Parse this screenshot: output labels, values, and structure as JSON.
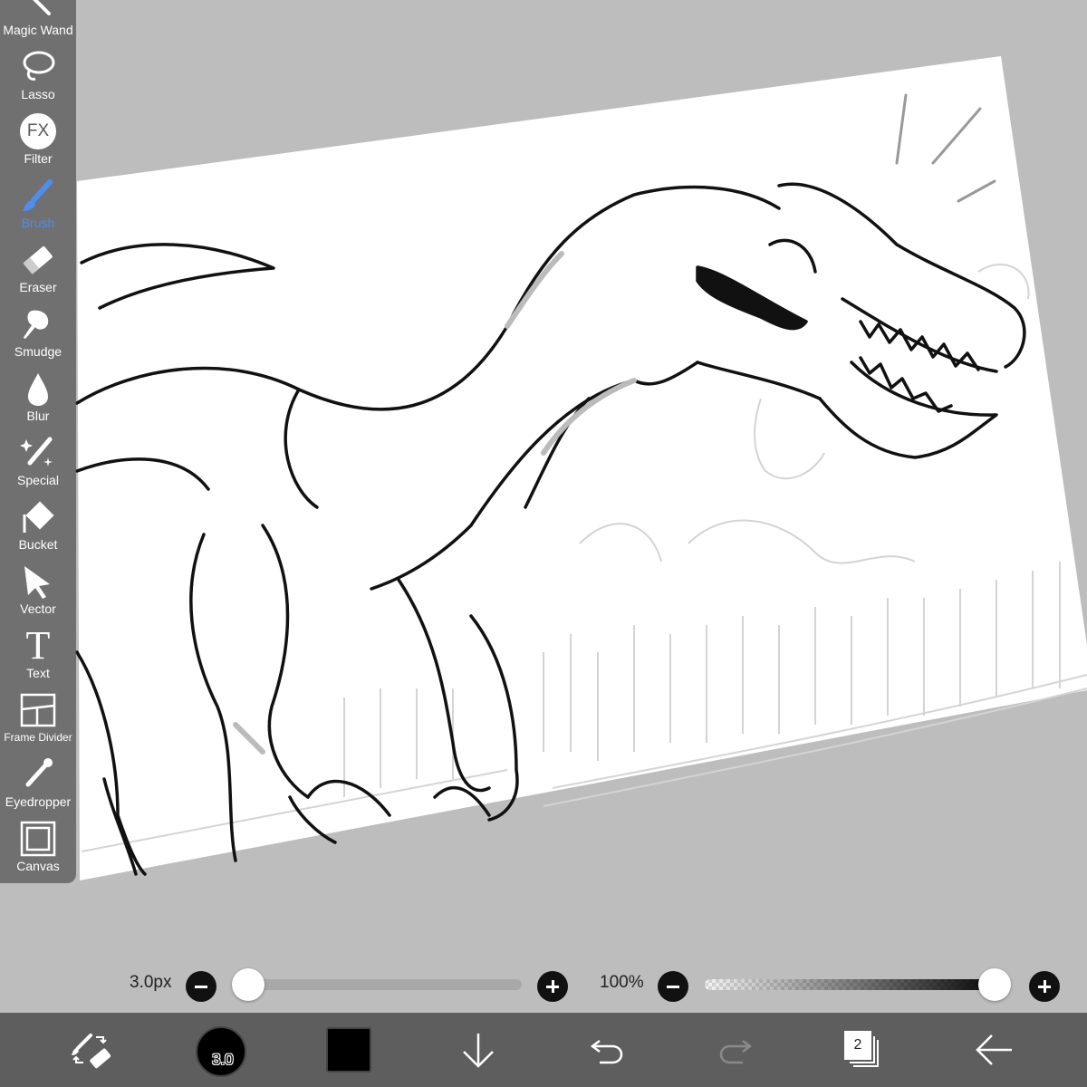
{
  "toolbox": {
    "items": [
      {
        "label": "Magic Wand",
        "icon": "magic-wand-icon"
      },
      {
        "label": "Lasso",
        "icon": "lasso-icon"
      },
      {
        "label": "Filter",
        "icon": "fx-filter-icon"
      },
      {
        "label": "Brush",
        "icon": "brush-icon",
        "active": true
      },
      {
        "label": "Eraser",
        "icon": "eraser-icon"
      },
      {
        "label": "Smudge",
        "icon": "smudge-icon"
      },
      {
        "label": "Blur",
        "icon": "blur-drop-icon"
      },
      {
        "label": "Special",
        "icon": "special-sparkle-icon"
      },
      {
        "label": "Bucket",
        "icon": "bucket-icon"
      },
      {
        "label": "Vector",
        "icon": "vector-arrow-icon"
      },
      {
        "label": "Text",
        "icon": "text-t-icon"
      },
      {
        "label": "Frame Divider",
        "icon": "frame-divider-icon"
      },
      {
        "label": "Eyedropper",
        "icon": "eyedropper-icon"
      },
      {
        "label": "Canvas",
        "icon": "canvas-icon"
      }
    ],
    "filter_glyph": "FX",
    "text_glyph": "T"
  },
  "brush_controls": {
    "size_label": "3.0px",
    "size_value": 3.0,
    "size_fraction": 0.0,
    "opacity_label": "100%",
    "opacity_fraction": 1.0
  },
  "bottom_bar": {
    "brush_size_indicator": "3.0",
    "current_color": "#000000",
    "layer_count": "2"
  },
  "colors": {
    "active_tool": "#4d8ef0",
    "toolbox_bg": "#5a5a5a",
    "bottom_bar_bg": "#5e5e5e",
    "workspace_bg": "#bdbdbd"
  }
}
